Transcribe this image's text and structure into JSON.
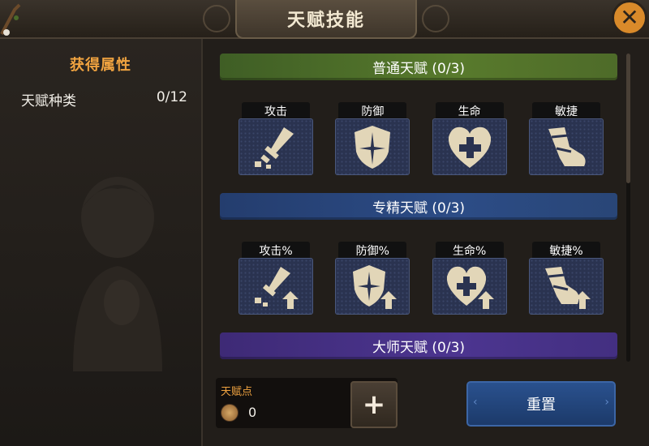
{
  "window": {
    "title": "天赋技能"
  },
  "colors": {
    "accent_orange": "#f0a340",
    "normal_header": "#587a2c",
    "specialist_header": "#2c4c86",
    "master_header": "#4c3590",
    "reset_button": "#2a518e",
    "close_button": "#d98a2a"
  },
  "left_panel": {
    "title": "获得属性",
    "stats": [
      {
        "label": "天赋种类",
        "value": "0/12"
      }
    ]
  },
  "sections": [
    {
      "header": "普通天赋 (0/3)",
      "skills": [
        {
          "label": "攻击",
          "icon": "sword-icon"
        },
        {
          "label": "防御",
          "icon": "shield-icon"
        },
        {
          "label": "生命",
          "icon": "heart-icon"
        },
        {
          "label": "敏捷",
          "icon": "boot-icon"
        }
      ]
    },
    {
      "header": "专精天赋 (0/3)",
      "skills": [
        {
          "label": "攻击%",
          "icon": "sword-up-icon"
        },
        {
          "label": "防御%",
          "icon": "shield-up-icon"
        },
        {
          "label": "生命%",
          "icon": "heart-up-icon"
        },
        {
          "label": "敏捷%",
          "icon": "boot-up-icon"
        }
      ]
    },
    {
      "header": "大师天赋 (0/3)",
      "skills": []
    }
  ],
  "talent_points": {
    "label": "天赋点",
    "value": "0",
    "icon": "coin-icon"
  },
  "buttons": {
    "add": "+",
    "reset": "重置",
    "close": "✕"
  }
}
